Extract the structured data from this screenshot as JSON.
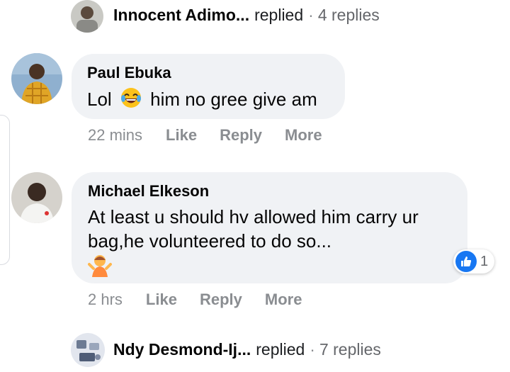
{
  "top_reply": {
    "name": "Innocent Adimo...",
    "verb": "replied",
    "dot": "·",
    "count": "4 replies"
  },
  "comment1": {
    "author": "Paul Ebuka",
    "text_before": "Lol",
    "emoji": "face-with-tears-of-joy",
    "text_after": "him no gree give am",
    "time": "22 mins",
    "like": "Like",
    "reply": "Reply",
    "more": "More"
  },
  "comment2": {
    "author": "Michael Elkeson",
    "line1": "At least u should hv allowed him carry ur",
    "line2": "bag,he volunteered to do so...",
    "emoji": "person-shrugging",
    "time": "2 hrs",
    "like": "Like",
    "reply": "Reply",
    "more": "More",
    "reaction_icon": "like-icon",
    "reaction_count": "1"
  },
  "bottom_reply": {
    "name": "Ndy Desmond-Ij...",
    "verb": "replied",
    "dot": "·",
    "count": "7 replies"
  },
  "colors": {
    "bubble": "#f0f2f5",
    "like_blue": "#1877f2",
    "secondary_text": "#65676b"
  }
}
